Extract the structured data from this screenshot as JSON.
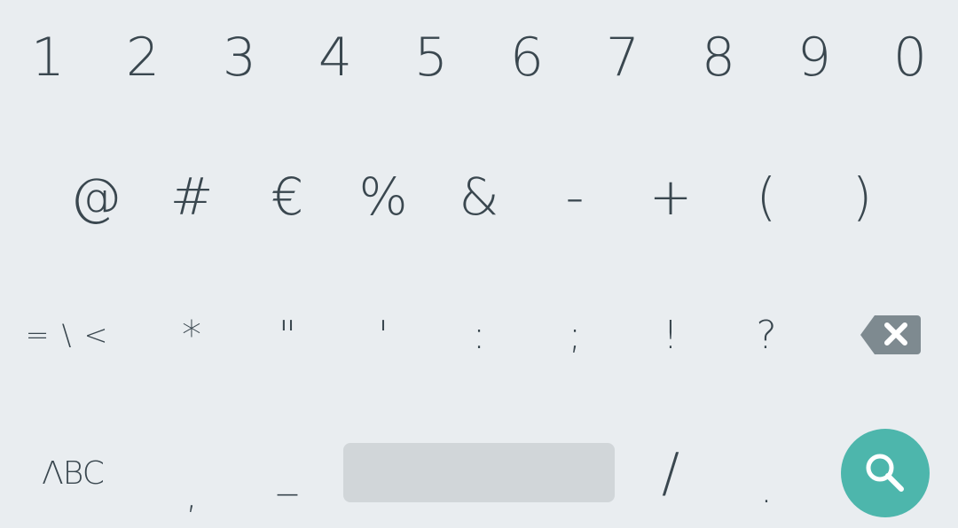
{
  "keyboard": {
    "row1": [
      "1",
      "2",
      "3",
      "4",
      "5",
      "6",
      "7",
      "8",
      "9",
      "0"
    ],
    "row2": [
      "@",
      "#",
      "€",
      "%",
      "&",
      "-",
      "+",
      "(",
      ")"
    ],
    "row3": {
      "more_symbols_label": "= \\ <",
      "keys": [
        "*",
        "\"",
        "'",
        ":",
        ";",
        "!",
        "?"
      ]
    },
    "row4": {
      "abc_label": "ΛBC",
      "keys_left": [
        ",",
        "_"
      ],
      "keys_right": [
        "/",
        "."
      ]
    }
  },
  "icons": {
    "backspace": "backspace-icon",
    "search": "search-icon"
  },
  "colors": {
    "background": "#e9edf0",
    "key_text": "#3a474f",
    "space_bar": "#d1d6d9",
    "backspace": "#7e8a90",
    "search_accent": "#4db6ac"
  }
}
